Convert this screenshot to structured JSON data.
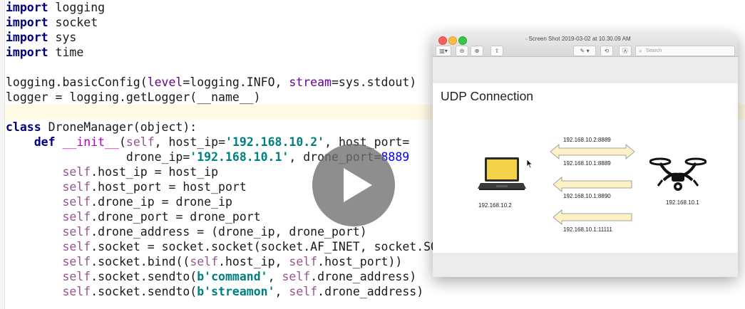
{
  "editor": {
    "lines": [
      {
        "segments": [
          {
            "t": "import",
            "c": "kw"
          },
          {
            "t": " logging"
          }
        ]
      },
      {
        "segments": [
          {
            "t": "import",
            "c": "kw"
          },
          {
            "t": " socket"
          }
        ]
      },
      {
        "segments": [
          {
            "t": "import",
            "c": "kw"
          },
          {
            "t": " sys"
          }
        ]
      },
      {
        "segments": [
          {
            "t": "import",
            "c": "kw"
          },
          {
            "t": " time"
          }
        ]
      },
      {
        "segments": []
      },
      {
        "segments": [
          {
            "t": "logging.basicConfig("
          },
          {
            "t": "level",
            "c": "kwarg"
          },
          {
            "t": "=logging.INFO, "
          },
          {
            "t": "stream",
            "c": "kwarg"
          },
          {
            "t": "=sys.stdout)"
          }
        ]
      },
      {
        "segments": [
          {
            "t": "logger = logging.getLogger(__name__)"
          }
        ]
      },
      {
        "segments": []
      },
      {
        "segments": [
          {
            "t": "class",
            "c": "kw"
          },
          {
            "t": " DroneManager(object):"
          }
        ]
      },
      {
        "segments": [
          {
            "t": "    "
          },
          {
            "t": "def",
            "c": "kw"
          },
          {
            "t": " "
          },
          {
            "t": "__init__",
            "c": "dunder"
          },
          {
            "t": "("
          },
          {
            "t": "self",
            "c": "selfk"
          },
          {
            "t": ", host_ip="
          },
          {
            "t": "'192.168.10.2'",
            "c": "str"
          },
          {
            "t": ", host_port="
          }
        ]
      },
      {
        "segments": [
          {
            "t": "                 drone_ip="
          },
          {
            "t": "'192.168.10.1'",
            "c": "str"
          },
          {
            "t": ", drone_port="
          },
          {
            "t": "8889",
            "c": "num"
          }
        ]
      },
      {
        "segments": [
          {
            "t": "        "
          },
          {
            "t": "self",
            "c": "selfk"
          },
          {
            "t": ".host_ip = host_ip"
          }
        ]
      },
      {
        "segments": [
          {
            "t": "        "
          },
          {
            "t": "self",
            "c": "selfk"
          },
          {
            "t": ".host_port = host_port"
          }
        ]
      },
      {
        "segments": [
          {
            "t": "        "
          },
          {
            "t": "self",
            "c": "selfk"
          },
          {
            "t": ".drone_ip = drone_ip"
          }
        ]
      },
      {
        "segments": [
          {
            "t": "        "
          },
          {
            "t": "self",
            "c": "selfk"
          },
          {
            "t": ".drone_port = drone_port"
          }
        ]
      },
      {
        "segments": [
          {
            "t": "        "
          },
          {
            "t": "self",
            "c": "selfk"
          },
          {
            "t": ".drone_address = (drone_ip, drone_port)"
          }
        ]
      },
      {
        "segments": [
          {
            "t": "        "
          },
          {
            "t": "self",
            "c": "selfk"
          },
          {
            "t": ".socket = socket.socket(socket.AF_INET, socket.SOCK_DGRAM)"
          }
        ]
      },
      {
        "segments": [
          {
            "t": "        "
          },
          {
            "t": "self",
            "c": "selfk"
          },
          {
            "t": ".socket.bind(("
          },
          {
            "t": "self",
            "c": "selfk"
          },
          {
            "t": ".host_ip, "
          },
          {
            "t": "self",
            "c": "selfk"
          },
          {
            "t": ".host_port))"
          }
        ]
      },
      {
        "segments": [
          {
            "t": "        "
          },
          {
            "t": "self",
            "c": "selfk"
          },
          {
            "t": ".socket.sendto("
          },
          {
            "t": "b'command'",
            "c": "str"
          },
          {
            "t": ", "
          },
          {
            "t": "self",
            "c": "selfk"
          },
          {
            "t": ".drone_address)"
          }
        ]
      },
      {
        "segments": [
          {
            "t": "        "
          },
          {
            "t": "self",
            "c": "selfk"
          },
          {
            "t": ".socket.sendto("
          },
          {
            "t": "b'streamon'",
            "c": "str"
          },
          {
            "t": ", "
          },
          {
            "t": "self",
            "c": "selfk"
          },
          {
            "t": ".drone_address)"
          }
        ]
      }
    ]
  },
  "viewer": {
    "title": "Screen Shot 2019-03-02 at 10.30.09 AM",
    "search_placeholder": "Search",
    "slide": {
      "title": "UDP Connection",
      "laptop_ip": "192.168.10.2",
      "drone_ip": "192.168.10.1",
      "arrows": [
        {
          "top_label": "192.168.10.2:8889",
          "bottom_label": "192.168.10.1:8889",
          "type": "double"
        },
        {
          "label": "192.168.10.1:8890",
          "type": "left"
        },
        {
          "label": "192.168.10.1:11111",
          "type": "left"
        }
      ]
    }
  },
  "colors": {
    "arrow_fill": "#fdf1c6",
    "arrow_stroke": "#8a8a8a",
    "keyword": "#000080",
    "string": "#008080"
  },
  "icons": [
    "sidebar-icon",
    "zoom-out-icon",
    "zoom-in-icon",
    "share-icon",
    "markup-icon",
    "rotate-icon",
    "annotate-icon",
    "search-icon",
    "play-icon",
    "laptop-icon",
    "drone-icon",
    "cursor-icon"
  ]
}
